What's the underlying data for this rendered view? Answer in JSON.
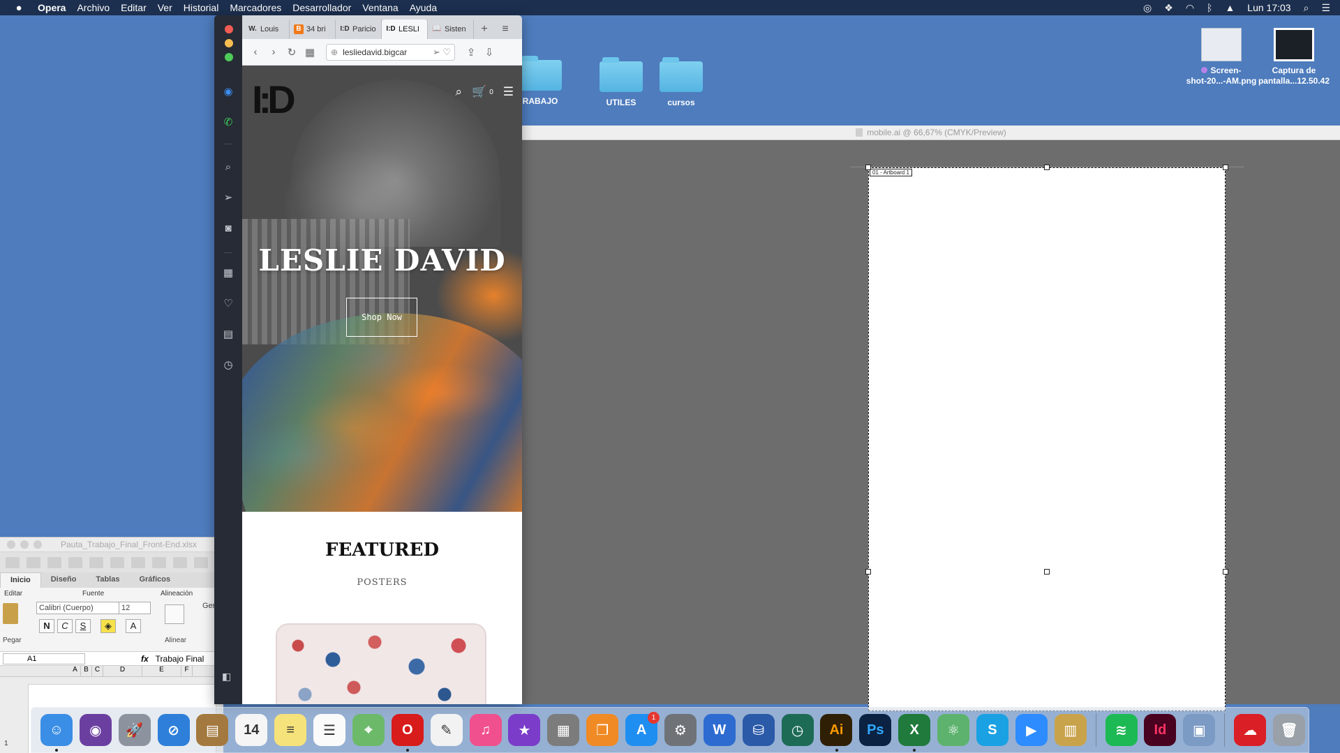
{
  "menubar": {
    "app": "Opera",
    "items": [
      "Archivo",
      "Editar",
      "Ver",
      "Historial",
      "Marcadores",
      "Desarrollador",
      "Ventana",
      "Ayuda"
    ],
    "clock": "Lun 17:03",
    "status_icons": [
      "creative-cloud-icon",
      "dropbox-icon",
      "wifi-icon",
      "bluetooth-icon",
      "airplay-icon",
      "search-icon",
      "control-center-icon"
    ]
  },
  "desktop": {
    "folders": [
      {
        "label": "RABAJO"
      },
      {
        "label": "UTILES"
      },
      {
        "label": "cursos"
      }
    ],
    "files": [
      {
        "label_line1": "Screen-",
        "label_line2": "shot-20...-AM.png"
      },
      {
        "label_line1": "Captura de",
        "label_line2": "pantalla...12.50.42"
      }
    ]
  },
  "illustrator": {
    "title": "mobile.ai @ 66,67% (CMYK/Preview)",
    "artboard_label": "01 - Artboard 1"
  },
  "excel": {
    "title": "Pauta_Trabajo_Final_Front-End.xlsx",
    "tabs": [
      "Inicio",
      "Diseño",
      "Tablas",
      "Gráficos"
    ],
    "group_editar": "Editar",
    "group_fuente": "Fuente",
    "group_alineacion": "Alineación",
    "paste_label": "Pegar",
    "align_label": "Alinear",
    "font_name": "Calibri (Cuerpo)",
    "font_size": "12",
    "bold": "N",
    "italic": "C",
    "underline": "S",
    "name_box": "A1",
    "fx": "fx",
    "formula_value": "Trabajo Final",
    "columns": [
      "A",
      "B",
      "C",
      "D",
      "E",
      "F"
    ],
    "general_cut": "Ger",
    "row_first": "1"
  },
  "opera": {
    "tabs": [
      {
        "favicon": "W.",
        "label": "Louis"
      },
      {
        "favicon": "B",
        "label": "34 bri"
      },
      {
        "favicon": "I:D",
        "label": "Paricio"
      },
      {
        "favicon": "I:D",
        "label": "LESLI"
      },
      {
        "favicon": "📖",
        "label": "Sisten"
      }
    ],
    "url": "lesliedavid.bigcar",
    "page": {
      "logo": "I:D",
      "cart_count": "0",
      "hero_title": "LESLIE DAVID",
      "shop_button": "Shop Now",
      "featured_heading": "FEATURED",
      "featured_sub": "POSTERS"
    }
  },
  "dock": {
    "apps": [
      {
        "name": "finder-icon",
        "color": "#3a8ee6",
        "glyph": "☺",
        "running": true
      },
      {
        "name": "siri-icon",
        "color": "#6b3fa0",
        "glyph": "◉",
        "running": false
      },
      {
        "name": "launchpad-icon",
        "color": "#8c939e",
        "glyph": "🚀",
        "running": false
      },
      {
        "name": "safari-icon",
        "color": "#2e7fd9",
        "glyph": "⊘",
        "running": false
      },
      {
        "name": "notebook-icon",
        "color": "#a4793f",
        "glyph": "▤",
        "running": false
      },
      {
        "name": "calendar-icon",
        "color": "#f5f5f5",
        "glyph": "14",
        "running": false
      },
      {
        "name": "notes-icon",
        "color": "#f6e27a",
        "glyph": "≡",
        "running": false
      },
      {
        "name": "reminders-icon",
        "color": "#fafafa",
        "glyph": "☰",
        "running": false
      },
      {
        "name": "maps-icon",
        "color": "#6db96a",
        "glyph": "⌖",
        "running": false
      },
      {
        "name": "opera-icon",
        "color": "#d81b1b",
        "glyph": "O",
        "running": true
      },
      {
        "name": "textedit-icon",
        "color": "#f2f2f2",
        "glyph": "✎",
        "running": false
      },
      {
        "name": "itunes-icon",
        "color": "#f0508d",
        "glyph": "♫",
        "running": false
      },
      {
        "name": "imovie-icon",
        "color": "#7a3cc9",
        "glyph": "★",
        "running": false
      },
      {
        "name": "calculator-icon",
        "color": "#7c7c7c",
        "glyph": "▦",
        "running": false
      },
      {
        "name": "books-icon",
        "color": "#f08a24",
        "glyph": "❒",
        "running": false
      },
      {
        "name": "app-store-icon",
        "color": "#1f8ef1",
        "glyph": "A",
        "running": false,
        "badge": "1"
      },
      {
        "name": "system-preferences-icon",
        "color": "#6f7378",
        "glyph": "⚙",
        "running": false
      },
      {
        "name": "word-icon",
        "color": "#2d6bd1",
        "glyph": "W",
        "running": false
      },
      {
        "name": "sqlite-icon",
        "color": "#2a5aa8",
        "glyph": "⛁",
        "running": false
      },
      {
        "name": "time-machine-icon",
        "color": "#1d6b55",
        "glyph": "◷",
        "running": false
      },
      {
        "name": "illustrator-icon",
        "color": "#2f1f05",
        "glyph": "Ai",
        "running": true
      },
      {
        "name": "photoshop-icon",
        "color": "#0b2242",
        "glyph": "Ps",
        "running": false
      },
      {
        "name": "excel-x-icon",
        "color": "#1f7a3b",
        "glyph": "X",
        "running": true
      },
      {
        "name": "atom-icon",
        "color": "#5db36e",
        "glyph": "⚛",
        "running": false
      },
      {
        "name": "skype-icon",
        "color": "#1aa1e3",
        "glyph": "S",
        "running": false
      },
      {
        "name": "zoom-icon",
        "color": "#2d8cff",
        "glyph": "▶",
        "running": false
      },
      {
        "name": "archive-utility-icon",
        "color": "#c9a34b",
        "glyph": "▥",
        "running": false
      }
    ],
    "apps_right": [
      {
        "name": "spotify-icon",
        "color": "#1db954",
        "glyph": "≋",
        "running": false
      },
      {
        "name": "indesign-icon",
        "color": "#49021f",
        "glyph": "Id",
        "running": false
      },
      {
        "name": "preview-icon",
        "color": "#7b9ac4",
        "glyph": "▣",
        "running": false
      }
    ],
    "apps_trash": [
      {
        "name": "creative-cloud-files-icon",
        "color": "#da1f26",
        "glyph": "☁",
        "running": false
      },
      {
        "name": "trash-icon",
        "color": "#9aa0a8",
        "glyph": "🗑",
        "running": false
      }
    ]
  }
}
